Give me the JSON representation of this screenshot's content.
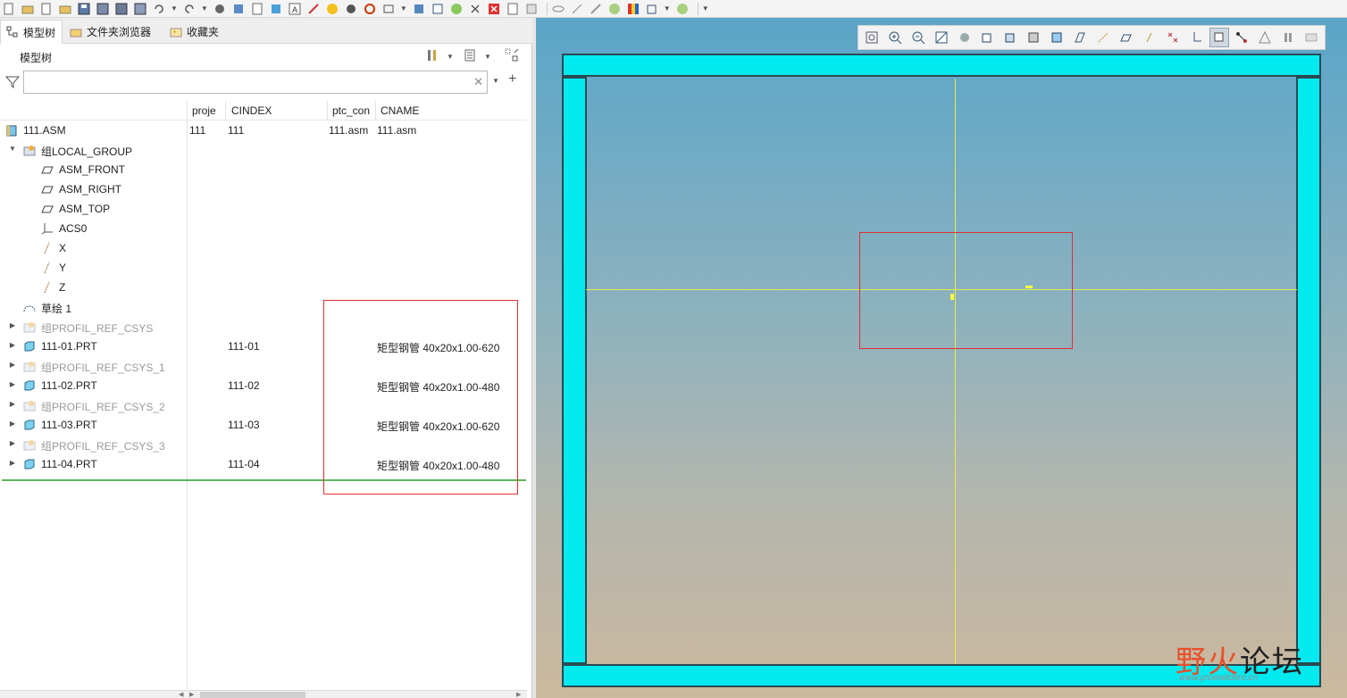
{
  "tabs": [
    {
      "label": "模型树",
      "active": true
    },
    {
      "label": "文件夹浏览器",
      "active": false
    },
    {
      "label": "收藏夹",
      "active": false
    }
  ],
  "panel": {
    "title": "模型树"
  },
  "search": {
    "value": "",
    "placeholder": ""
  },
  "columns": [
    "proje",
    "CINDEX",
    "ptc_con",
    "CNAME"
  ],
  "tree": [
    {
      "label": "111.ASM",
      "icon": "assembly-icon",
      "expander": "",
      "indent": 0,
      "grey": false,
      "cols": [
        "111",
        "111",
        "111.asm",
        "111.asm"
      ]
    },
    {
      "label": "组LOCAL_GROUP",
      "icon": "group-icon",
      "expander": "down",
      "indent": 1,
      "grey": false,
      "cols": [
        "",
        "",
        "",
        ""
      ]
    },
    {
      "label": "ASM_FRONT",
      "icon": "datum-plane-icon",
      "expander": "",
      "indent": 2,
      "grey": false,
      "cols": [
        "",
        "",
        "",
        ""
      ]
    },
    {
      "label": "ASM_RIGHT",
      "icon": "datum-plane-icon",
      "expander": "",
      "indent": 2,
      "grey": false,
      "cols": [
        "",
        "",
        "",
        ""
      ]
    },
    {
      "label": "ASM_TOP",
      "icon": "datum-plane-icon",
      "expander": "",
      "indent": 2,
      "grey": false,
      "cols": [
        "",
        "",
        "",
        ""
      ]
    },
    {
      "label": "ACS0",
      "icon": "csys-icon",
      "expander": "",
      "indent": 2,
      "grey": false,
      "cols": [
        "",
        "",
        "",
        ""
      ]
    },
    {
      "label": "X",
      "icon": "axis-icon",
      "expander": "",
      "indent": 2,
      "grey": false,
      "cols": [
        "",
        "",
        "",
        ""
      ]
    },
    {
      "label": "Y",
      "icon": "axis-icon",
      "expander": "",
      "indent": 2,
      "grey": false,
      "cols": [
        "",
        "",
        "",
        ""
      ]
    },
    {
      "label": "Z",
      "icon": "axis-icon",
      "expander": "",
      "indent": 2,
      "grey": false,
      "cols": [
        "",
        "",
        "",
        ""
      ]
    },
    {
      "label": "草绘 1",
      "icon": "sketch-icon",
      "expander": "",
      "indent": 1,
      "grey": false,
      "cols": [
        "",
        "",
        "",
        ""
      ]
    },
    {
      "label": "组PROFIL_REF_CSYS",
      "icon": "group-icon",
      "expander": "right",
      "indent": 1,
      "grey": true,
      "cols": [
        "",
        "",
        "",
        ""
      ]
    },
    {
      "label": "111-01.PRT",
      "icon": "part-icon",
      "expander": "right",
      "indent": 1,
      "grey": false,
      "cols": [
        "",
        "111-01",
        "",
        "矩型钢管 40x20x1.00-620"
      ]
    },
    {
      "label": "组PROFIL_REF_CSYS_1",
      "icon": "group-icon",
      "expander": "right",
      "indent": 1,
      "grey": true,
      "cols": [
        "",
        "",
        "",
        ""
      ]
    },
    {
      "label": "111-02.PRT",
      "icon": "part-icon",
      "expander": "right",
      "indent": 1,
      "grey": false,
      "cols": [
        "",
        "111-02",
        "",
        "矩型钢管 40x20x1.00-480"
      ]
    },
    {
      "label": "组PROFIL_REF_CSYS_2",
      "icon": "group-icon",
      "expander": "right",
      "indent": 1,
      "grey": true,
      "cols": [
        "",
        "",
        "",
        ""
      ]
    },
    {
      "label": "111-03.PRT",
      "icon": "part-icon",
      "expander": "right",
      "indent": 1,
      "grey": false,
      "cols": [
        "",
        "111-03",
        "",
        "矩型钢管 40x20x1.00-620"
      ]
    },
    {
      "label": "组PROFIL_REF_CSYS_3",
      "icon": "group-icon",
      "expander": "right",
      "indent": 1,
      "grey": true,
      "cols": [
        "",
        "",
        "",
        ""
      ]
    },
    {
      "label": "111-04.PRT",
      "icon": "part-icon",
      "expander": "right",
      "indent": 1,
      "grey": false,
      "cols": [
        "",
        "111-04",
        "",
        "矩型钢管 40x20x1.00-480"
      ]
    }
  ],
  "watermark": {
    "main": "野火",
    "second": "论坛",
    "url": "www.proewildfire.cn"
  },
  "colors": {
    "beam": "#00eaf0",
    "accent_red": "#e03030",
    "tree_separator": "#5ab85a",
    "ref_line": "#e6ee4a"
  }
}
